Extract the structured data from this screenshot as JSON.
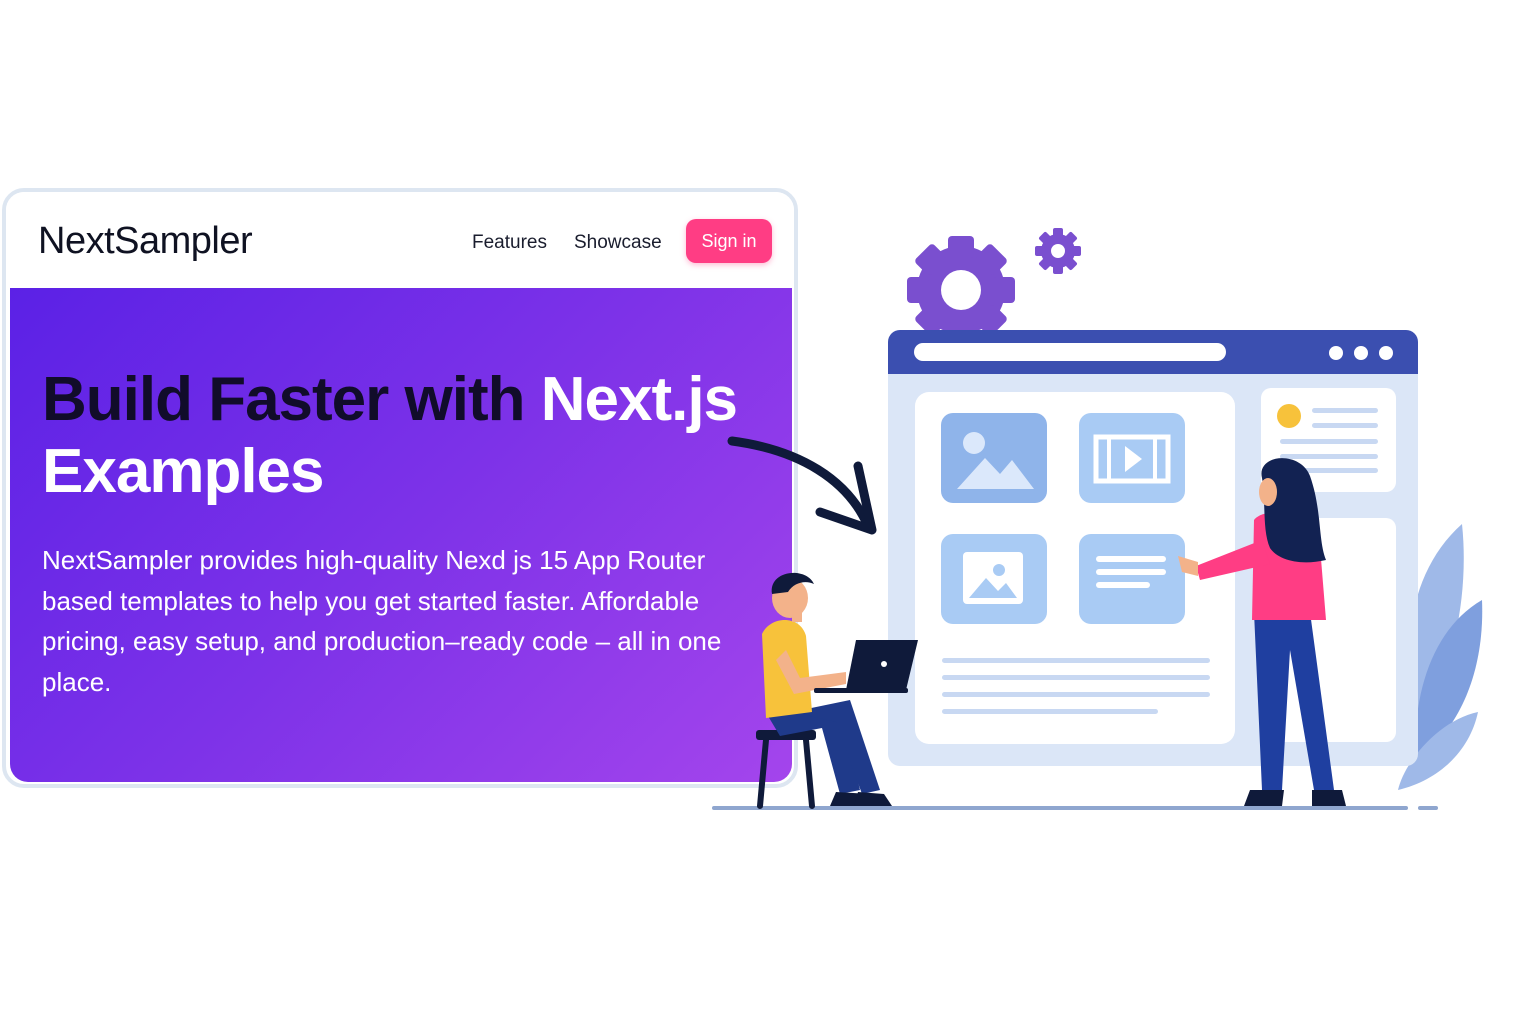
{
  "brand": {
    "name": "NextSampler"
  },
  "nav": {
    "links": [
      {
        "label": "Features"
      },
      {
        "label": "Showcase"
      }
    ],
    "sign_in_label": "Sign in"
  },
  "hero": {
    "headline_dark": "Build Faster with ",
    "headline_light_1": "Next.js",
    "headline_light_2": "Examples",
    "description": "NextSampler provides high-quality Nexd js 15 App Router based templates to help you get started faster. Affordable pricing, easy setup, and production–ready code – all in one place."
  },
  "colors": {
    "accent_pink": "#ff3d84",
    "gradient_start": "#5b21e6",
    "gradient_end": "#a445ec",
    "browser_bar": "#3b4fb0",
    "gear_purple": "#7a4fcf"
  },
  "illustration": {
    "icons": [
      "gear-icon",
      "image-icon",
      "video-icon",
      "text-lines-icon",
      "laptop-icon",
      "leaf-icon",
      "arrow-icon"
    ]
  }
}
